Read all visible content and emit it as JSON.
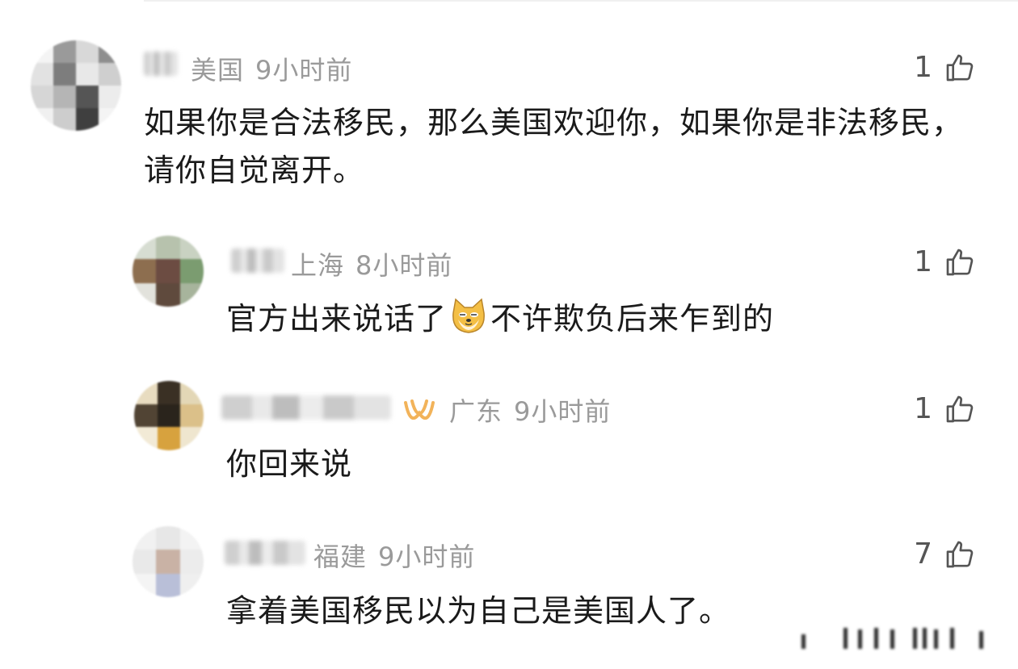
{
  "comments": [
    {
      "region": "美国",
      "time": "9小时前",
      "likes": "1",
      "text": "如果你是合法移民，那么美国欢迎你，如果你是非法移民，请你自觉离开。"
    },
    {
      "region": "上海",
      "time": "8小时前",
      "likes": "1",
      "text_before": "官方出来说话了",
      "emoji": "doge-emoji",
      "text_after": "不许欺负后来乍到的"
    },
    {
      "region": "广东",
      "time": "9小时前",
      "likes": "1",
      "badge": "membership-badge-icon",
      "text": "你回来说"
    },
    {
      "region": "福建",
      "time": "9小时前",
      "likes": "7",
      "text": "拿着美国移民以为自己是美国人了。"
    }
  ],
  "colors": {
    "meta_text": "#9a9a9a",
    "body_text": "#1a1a1a",
    "badge": "#f2b35a"
  },
  "icons": {
    "like": "thumbs-up-icon"
  }
}
